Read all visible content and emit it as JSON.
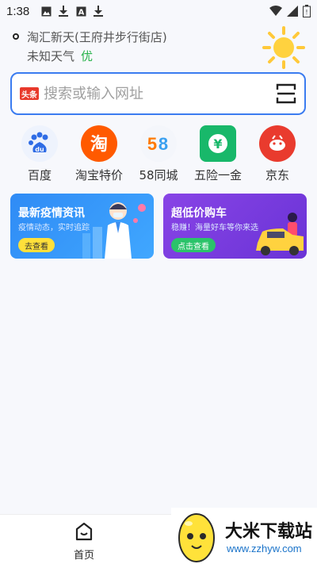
{
  "status_bar": {
    "time": "1:38"
  },
  "location": {
    "name": "淘汇新天(王府井步行街店)",
    "weather": "未知天气",
    "air_quality": "优"
  },
  "search": {
    "badge": "头条",
    "placeholder": "搜索或输入网址"
  },
  "shortcuts": [
    {
      "label": "百度",
      "icon": "baidu-icon",
      "color": "#2f6ce5"
    },
    {
      "label": "淘宝特价",
      "icon": "taobao-icon",
      "color": "#ff5a00"
    },
    {
      "label": "58同城",
      "icon": "58-icon",
      "color": "#ff7a00"
    },
    {
      "label": "五险一金",
      "icon": "yen-icon",
      "color": "#18b86a"
    },
    {
      "label": "京东",
      "icon": "jd-icon",
      "color": "#e93b2e"
    }
  ],
  "banners": [
    {
      "title": "最新疫情资讯",
      "subtitle": "疫情动态，实时追踪",
      "button": "去查看"
    },
    {
      "title": "超低价购车",
      "subtitle": "稳赚！海量好车等你来选",
      "button": "点击查看"
    }
  ],
  "bottom_nav": {
    "home_label": "首页"
  },
  "watermark": {
    "text": "大米下载站",
    "url": "www.zzhyw.com"
  }
}
